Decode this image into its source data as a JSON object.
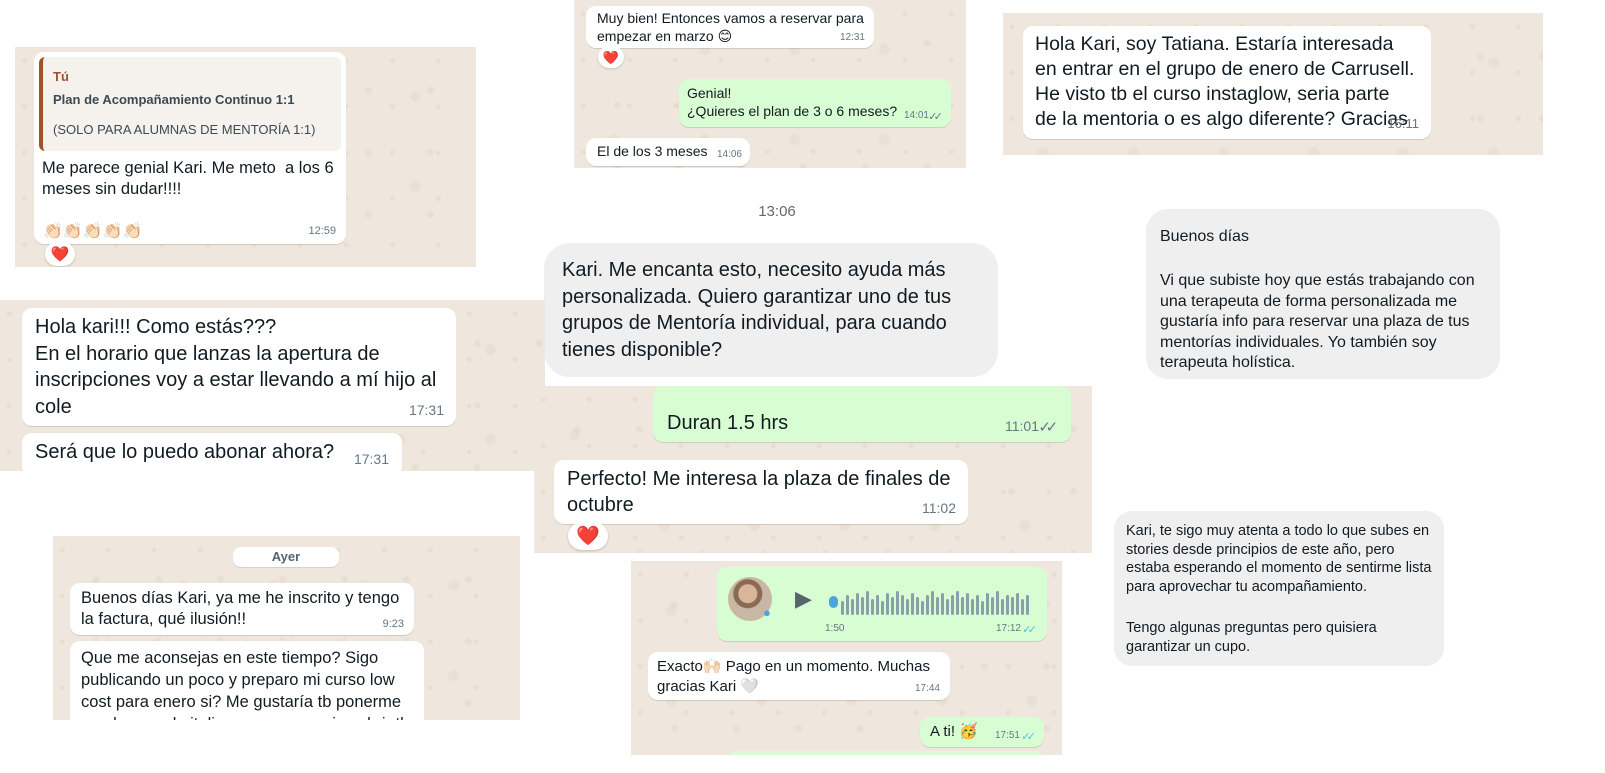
{
  "p1": {
    "quote_author": "Tú",
    "quote_title": "Plan de Acompañamiento Continuo 1:1",
    "quote_note": "(SOLO PARA ALUMNAS DE MENTORÍA 1:1)",
    "text": "Me parece genial Kari. Me meto  a los 6 meses sin dudar!!!!",
    "emojis": "👏🏻👏🏻👏🏻👏🏻👏🏻",
    "time": "12:59",
    "reaction": "❤️"
  },
  "p2": {
    "m1": "Muy bien! Entonces vamos a reservar para empezar en marzo 😊",
    "m1_time": "12:31",
    "m1_reaction": "❤️",
    "m2": "Genial!\n¿Quieres el plan de 3 o 6 meses?",
    "m2_time": "14:01",
    "m3": "El de los 3 meses",
    "m3_time": "14:06"
  },
  "p3": {
    "text": "Hola Kari, soy Tatiana. Estaría interesada en entrar en el grupo de enero de Carrusell. He visto tb el curso instaglow, seria parte de la mentoria o es algo diferente? Gracias",
    "time": "16:11"
  },
  "p4": {
    "timestamp": "13:06",
    "text": "Kari. Me encanta esto, necesito ayuda más personalizada. Quiero garantizar uno de tus grupos de Mentoría individual, para cuando tienes disponible?"
  },
  "p5": {
    "greeting": "Buenos días",
    "text": "Vi que subiste hoy que estás trabajando con una terapeuta de forma personalizada me gustaría info para reservar una plaza de tus mentorías individuales. Yo también soy terapeuta holística."
  },
  "p6": {
    "m1": "Hola kari!!! Como estás???\nEn el horario que lanzas la apertura de inscripciones voy a estar llevando a mí hijo al cole",
    "m1_time": "17:31",
    "m2": "Será que lo puedo abonar ahora?",
    "m2_time": "17:31"
  },
  "p7": {
    "m1": "Duran 1.5 hrs",
    "m1_time": "11:01",
    "m2": "Perfecto! Me interesa la plaza de finales de octubre",
    "m2_time": "11:02",
    "m2_reaction": "❤️"
  },
  "p8": {
    "p1": "Kari, te sigo muy atenta a todo lo que subes en stories desde principios de este año, pero estaba esperando el momento de sentirme lista para aprovechar tu acompañamiento.",
    "p2": "Tengo algunas preguntas pero quisiera garantizar un cupo."
  },
  "p9": {
    "day": "Ayer",
    "m1": "Buenos días Kari, ya me he inscrito y tengo la factura, qué ilusión!!",
    "m1_time": "9:23",
    "m2": "Que me aconsejas en este tiempo? Sigo publicando un poco y preparo mi curso low cost para enero si? Me gustaría tb ponerme en el mercado italiano, me aconsejas abrir tb"
  },
  "p10": {
    "voice_duration": "1:50",
    "voice_time": "17:12",
    "m1": "Exacto🙌🏻 Pago en un momento. Muchas gracias Kari 🤍",
    "m1_time": "17:44",
    "m2": "A ti! 🥳",
    "m2_time": "17:51"
  },
  "colors": {
    "wa_background": "#efe7dd",
    "outgoing_bubble": "#d9fdd3",
    "incoming_bubble": "#ffffff",
    "instagram_bubble": "#efeff0",
    "read_ticks": "#53bdeb",
    "quote_bar": "#a0522d"
  },
  "icons": {
    "double_tick": "double-check-icon",
    "play": "play-icon",
    "mic": "microphone-icon",
    "heart": "heart-reaction-icon"
  }
}
